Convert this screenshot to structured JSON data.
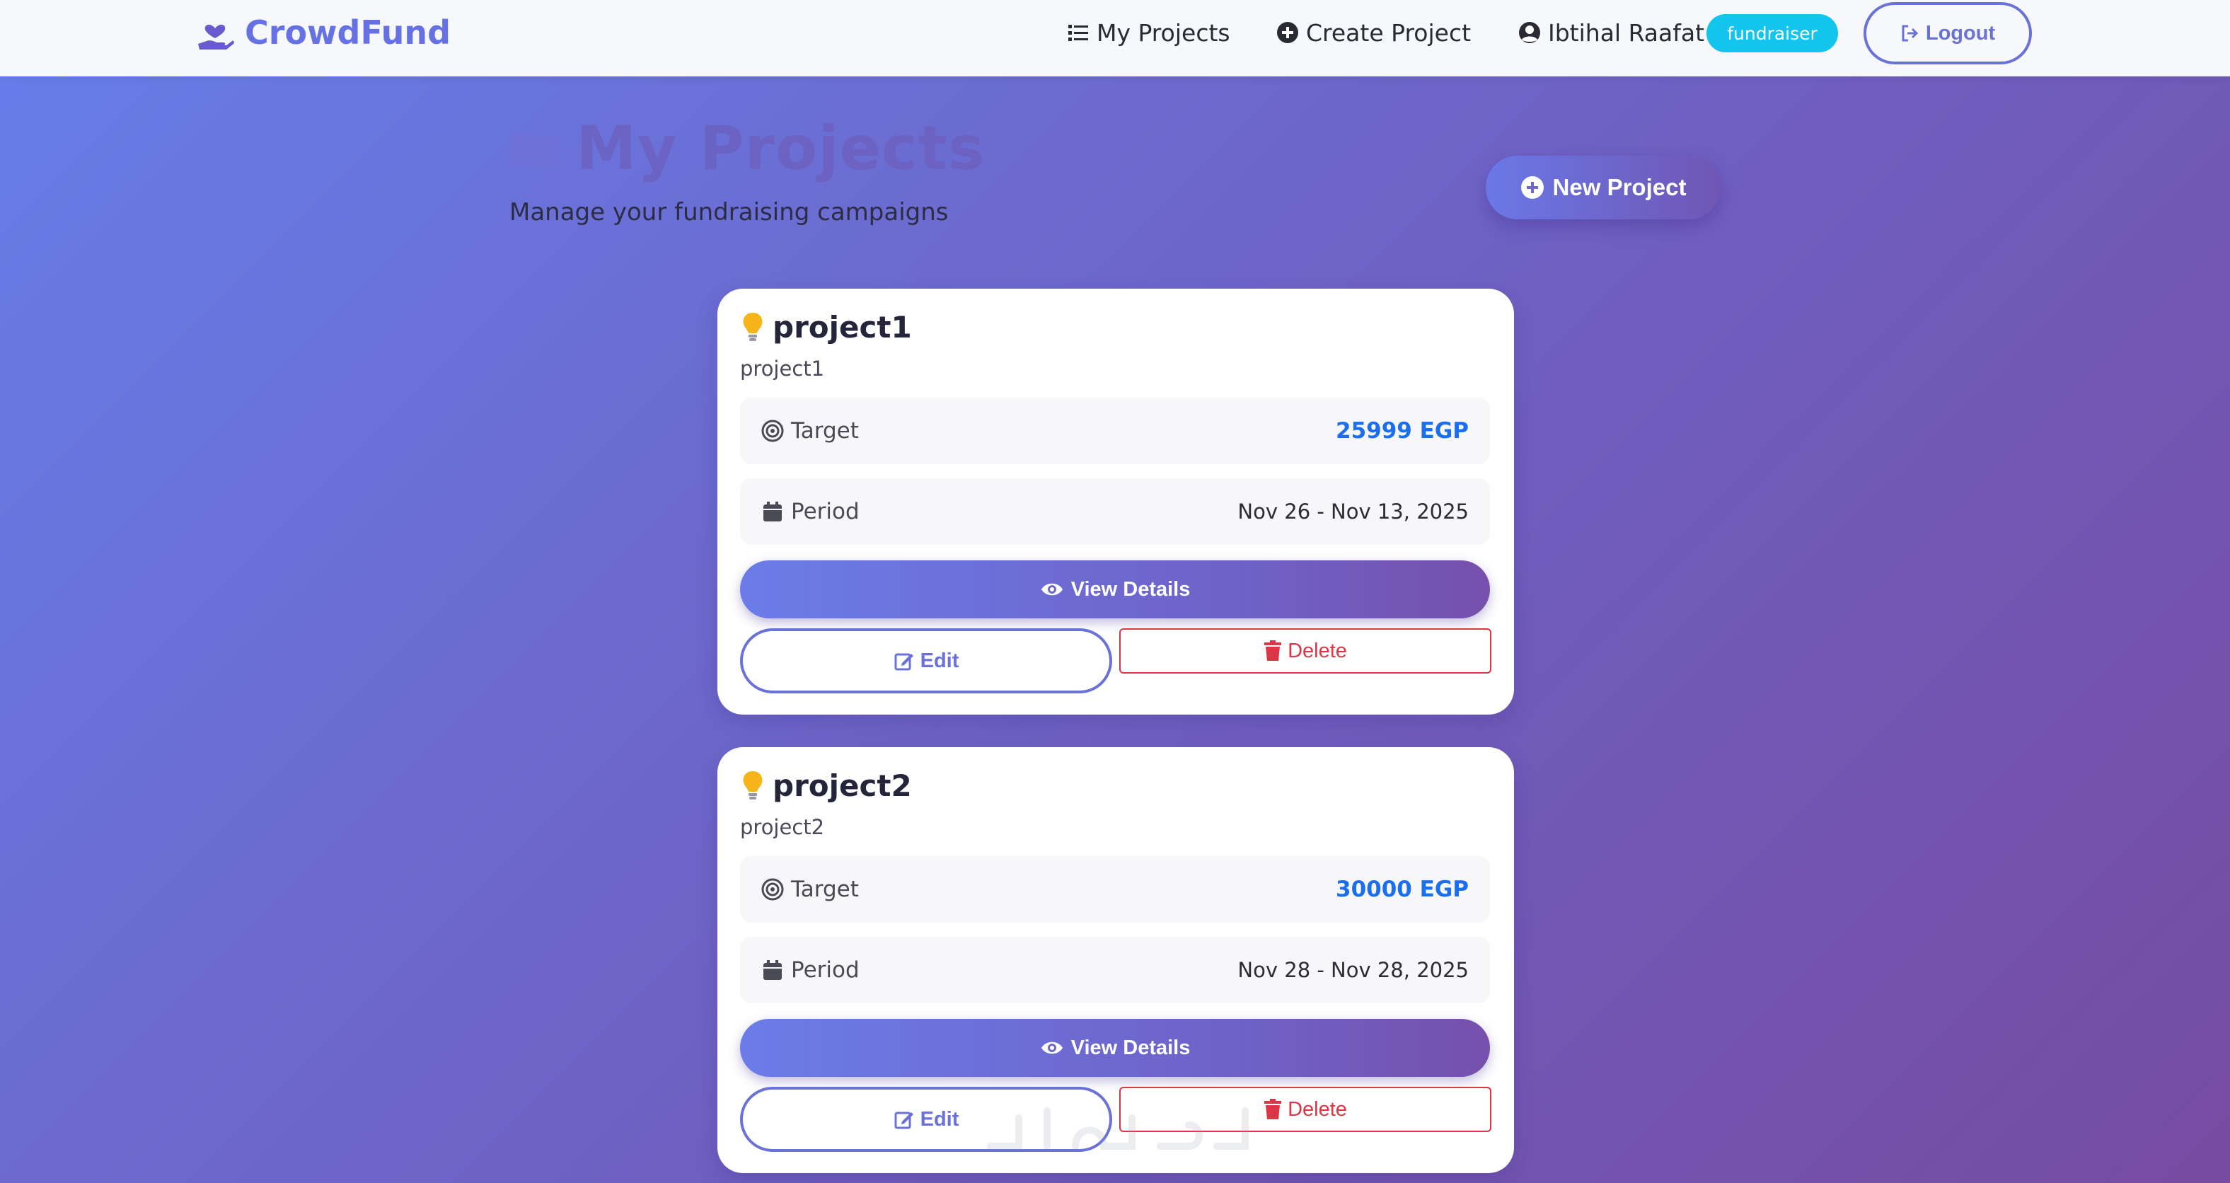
{
  "navbar": {
    "brand": "CrowdFund",
    "brand_icon": "hand-holding-heart-icon",
    "my_projects": "My Projects",
    "create_project": "Create Project",
    "user_name": "Ibtihal Raafat",
    "role_badge": "fundraiser",
    "logout": "Logout",
    "colors": {
      "brand": "#6671e4",
      "badge": "#13c5ec",
      "outline": "#6a72d8"
    }
  },
  "header": {
    "title": "My Projects",
    "subtitle": "Manage your fundraising campaigns",
    "new_project": "New Project"
  },
  "labels": {
    "target": "Target",
    "period": "Period",
    "view_details": "View Details",
    "edit": "Edit",
    "delete": "Delete"
  },
  "projects": [
    {
      "title": "project1",
      "description": "project1",
      "target": "25999 EGP",
      "period": "Nov 26 - Nov 13, 2025"
    },
    {
      "title": "project2",
      "description": "project2",
      "target": "30000 EGP",
      "period": "Nov 28 - Nov 28, 2025"
    }
  ],
  "theme": {
    "background_start": "#667eea",
    "background_end": "#764ba2",
    "target_color": "#1a6ff0",
    "danger": "#dc3545"
  }
}
